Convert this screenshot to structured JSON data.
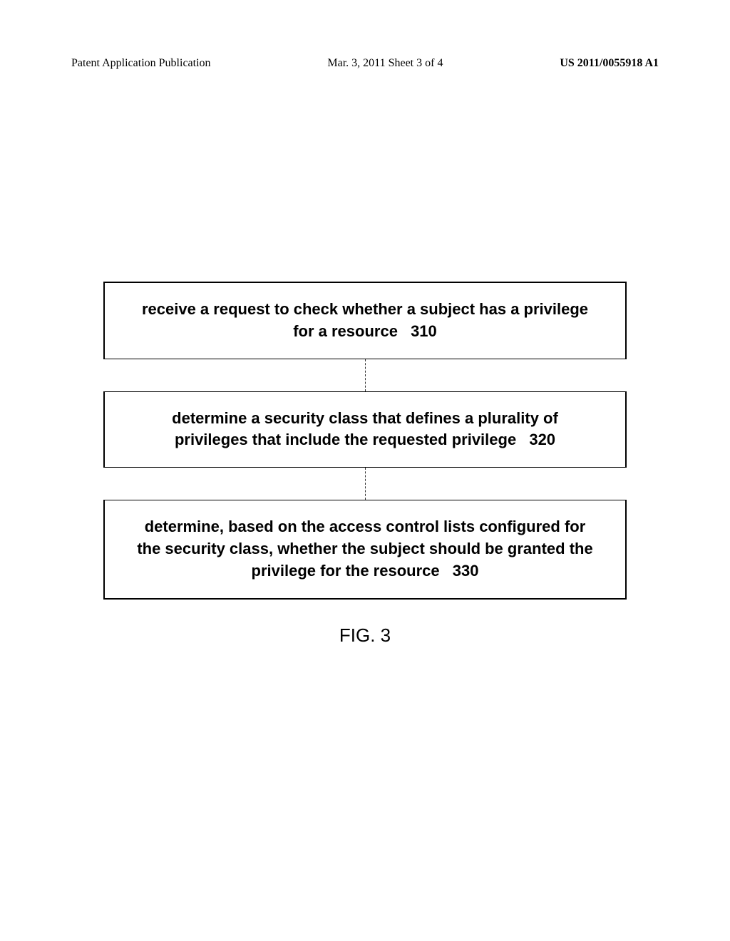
{
  "header": {
    "left": "Patent Application Publication",
    "center": "Mar. 3, 2011  Sheet 3 of 4",
    "right": "US 2011/0055918 A1"
  },
  "flowchart": {
    "step1_text": "receive a request to check whether a subject has a privilege for a resource",
    "step1_num": "310",
    "step2_text": "determine a security class that defines a plurality of privileges that include the requested privilege",
    "step2_num": "320",
    "step3_text": "determine, based on the access control lists configured for the security class, whether the subject should be granted the privilege for the resource",
    "step3_num": "330"
  },
  "figure_label": "FIG. 3"
}
